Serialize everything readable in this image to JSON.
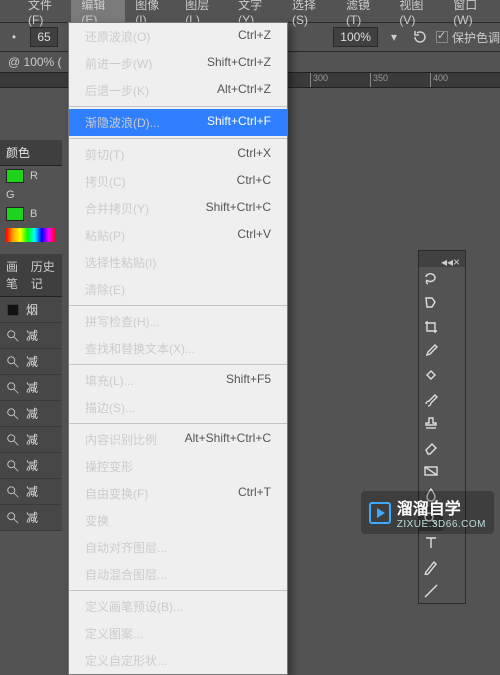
{
  "menubar": {
    "items": [
      "文件(F)",
      "编辑(E)",
      "图像(I)",
      "图层(L)",
      "文字(Y)",
      "选择(S)",
      "滤镜(T)",
      "视图(V)",
      "窗口(W)"
    ],
    "active_index": 1
  },
  "toolbar": {
    "brush_size": "65",
    "zoom_value": "100%",
    "preserve_tone_label": "保护色调"
  },
  "docinfo": "@ 100% (",
  "ruler": {
    "ticks": [
      "300",
      "350",
      "400"
    ]
  },
  "dropdown": {
    "groups": [
      [
        {
          "label": "还原波浪(O)",
          "shortcut": "Ctrl+Z"
        },
        {
          "label": "前进一步(W)",
          "shortcut": "Shift+Ctrl+Z"
        },
        {
          "label": "后退一步(K)",
          "shortcut": "Alt+Ctrl+Z"
        }
      ],
      [
        {
          "label": "渐隐波浪(D)...",
          "shortcut": "Shift+Ctrl+F",
          "selected": true
        }
      ],
      [
        {
          "label": "剪切(T)",
          "shortcut": "Ctrl+X"
        },
        {
          "label": "拷贝(C)",
          "shortcut": "Ctrl+C"
        },
        {
          "label": "合并拷贝(Y)",
          "shortcut": "Shift+Ctrl+C"
        },
        {
          "label": "粘贴(P)",
          "shortcut": "Ctrl+V"
        },
        {
          "label": "选择性粘贴(I)",
          "shortcut": ""
        },
        {
          "label": "清除(E)",
          "shortcut": "",
          "disabled": true
        }
      ],
      [
        {
          "label": "拼写检查(H)...",
          "shortcut": "",
          "disabled": true
        },
        {
          "label": "查找和替换文本(X)...",
          "shortcut": "",
          "disabled": true
        }
      ],
      [
        {
          "label": "填充(L)...",
          "shortcut": "Shift+F5"
        },
        {
          "label": "描边(S)...",
          "shortcut": ""
        }
      ],
      [
        {
          "label": "内容识别比例",
          "shortcut": "Alt+Shift+Ctrl+C"
        },
        {
          "label": "操控变形",
          "shortcut": ""
        },
        {
          "label": "自由变换(F)",
          "shortcut": "Ctrl+T"
        },
        {
          "label": "变换",
          "shortcut": ""
        },
        {
          "label": "自动对齐图层...",
          "shortcut": "",
          "disabled": true
        },
        {
          "label": "自动混合图层...",
          "shortcut": "",
          "disabled": true
        }
      ],
      [
        {
          "label": "定义画笔预设(B)...",
          "shortcut": ""
        },
        {
          "label": "定义图案...",
          "shortcut": ""
        },
        {
          "label": "定义自定形状...",
          "shortcut": "",
          "disabled": true
        }
      ]
    ]
  },
  "panels": {
    "color_title": "颜色",
    "r_label": "R",
    "g_label": "G",
    "b_label": "B",
    "brush_title": "画笔",
    "history_title": "历史记",
    "history_items": [
      "烟",
      "减",
      "减",
      "减",
      "减",
      "减",
      "减",
      "减",
      "减"
    ]
  },
  "tool_icons": [
    "lasso",
    "lasso-poly",
    "crop",
    "eyedropper",
    "heal",
    "brush",
    "stamp",
    "eraser",
    "gradient",
    "blur",
    "dodge",
    "type",
    "pen",
    "line"
  ],
  "watermark": {
    "text": "溜溜自学",
    "sub": "ZIXUE.3D66.COM"
  }
}
